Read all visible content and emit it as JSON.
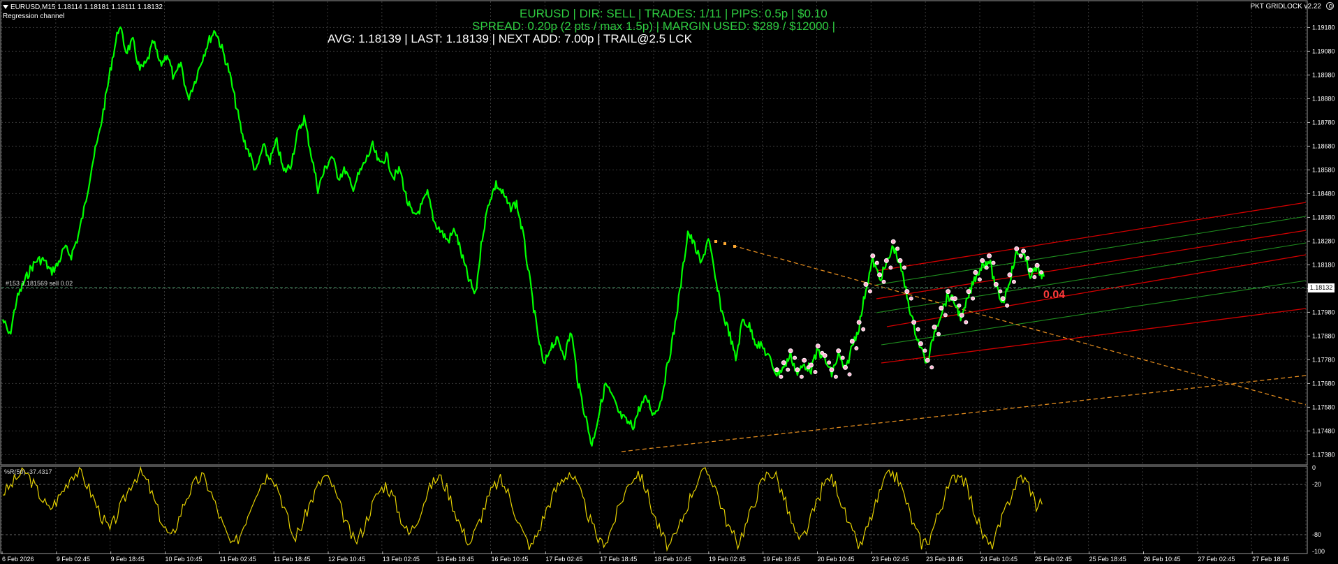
{
  "header": {
    "symbol_info": "EURUSD,M15  1.18114 1.18181 1.18111 1.18132",
    "indicator_name": "Regression channel",
    "ea_name": "PKT GRIDLOCK v2.22"
  },
  "hud": {
    "line1": "EURUSD | DIR: SELL | TRADES: 1/11 | PIPS: 0.5p | $0.10",
    "line2": "SPREAD: 0.20p (2 pts / max 1.5p) | MARGIN USED: $289 / $12000 |",
    "line3": "AVG: 1.18139 | LAST: 1.18139 | NEXT ADD: 7.00p | TRAIL@2.5 LCK"
  },
  "order_label": "#153 1.181569 sell 0.02",
  "current_price": "1.18132",
  "profit_label": "0.04",
  "subwindow": {
    "label": "%R(50) -37.4317",
    "ticks": [
      "0",
      "-20",
      "-80",
      "-100"
    ]
  },
  "colors": {
    "background": "#000000",
    "grid": "#3a3a3a",
    "price_line": "#00ff00",
    "oscillator": "#e6d200",
    "channel_red": "#d40000",
    "channel_green": "#1f8f1f",
    "trend_orange": "#e08a1e",
    "hud_green": "#2ecc40"
  },
  "chart_data": [
    {
      "type": "line",
      "symbol": "EURUSD",
      "timeframe": "M15",
      "y_ticks": [
        "1.19180",
        "1.19080",
        "1.18980",
        "1.18880",
        "1.18780",
        "1.18680",
        "1.18580",
        "1.18480",
        "1.18380",
        "1.18280",
        "1.18180",
        "1.18080",
        "1.17980",
        "1.17880",
        "1.17780",
        "1.17680",
        "1.17580",
        "1.17480",
        "1.17380"
      ],
      "ylim": [
        1.1734,
        1.1929
      ],
      "x_ticks": [
        "6 Feb 2026",
        "9 Feb 02:45",
        "9 Feb 18:45",
        "10 Feb 10:45",
        "11 Feb 02:45",
        "11 Feb 18:45",
        "12 Feb 10:45",
        "13 Feb 02:45",
        "13 Feb 18:45",
        "16 Feb 10:45",
        "17 Feb 02:45",
        "17 Feb 18:45",
        "18 Feb 10:45",
        "19 Feb 02:45",
        "19 Feb 18:45",
        "20 Feb 10:45",
        "23 Feb 02:45",
        "23 Feb 18:45",
        "24 Feb 10:45",
        "25 Feb 02:45",
        "25 Feb 18:45",
        "26 Feb 10:45",
        "27 Feb 02:45",
        "27 Feb 18:45"
      ],
      "series": [
        {
          "values": [
            1.1795,
            1.1788,
            1.1803,
            1.181,
            1.1816,
            1.182,
            1.182,
            1.1815,
            1.1818,
            1.1825,
            1.1822,
            1.183,
            1.1843,
            1.186,
            1.1872,
            1.1888,
            1.1905,
            1.1919,
            1.1908,
            1.1912,
            1.19,
            1.1903,
            1.1912,
            1.1902,
            1.1907,
            1.1896,
            1.1903,
            1.1888,
            1.1895,
            1.1904,
            1.1912,
            1.1917,
            1.1909,
            1.19,
            1.1886,
            1.1872,
            1.1865,
            1.1857,
            1.1868,
            1.1862,
            1.187,
            1.1857,
            1.186,
            1.1873,
            1.188,
            1.1865,
            1.185,
            1.1858,
            1.1864,
            1.1855,
            1.1858,
            1.185,
            1.1856,
            1.1862,
            1.1868,
            1.186,
            1.1864,
            1.1855,
            1.1858,
            1.1845,
            1.1838,
            1.1842,
            1.1848,
            1.1836,
            1.1832,
            1.1828,
            1.1833,
            1.1822,
            1.1812,
            1.1805,
            1.183,
            1.1845,
            1.1852,
            1.1848,
            1.1842,
            1.1844,
            1.183,
            1.181,
            1.179,
            1.1775,
            1.1784,
            1.1786,
            1.178,
            1.179,
            1.1768,
            1.1755,
            1.1742,
            1.1755,
            1.1768,
            1.1762,
            1.1755,
            1.1752,
            1.175,
            1.1758,
            1.1762,
            1.1755,
            1.176,
            1.1775,
            1.179,
            1.181,
            1.1832,
            1.1826,
            1.1818,
            1.183,
            1.1812,
            1.1798,
            1.179,
            1.1778,
            1.1795,
            1.1792,
            1.1785,
            1.1783,
            1.1778,
            1.1772,
            1.1775,
            1.178,
            1.1772,
            1.1776,
            1.1774,
            1.1782,
            1.1778,
            1.1772,
            1.178,
            1.1773,
            1.1784,
            1.1792,
            1.1808,
            1.182,
            1.1812,
            1.1818,
            1.1826,
            1.1818,
            1.1805,
            1.1792,
            1.1783,
            1.1776,
            1.179,
            1.1798,
            1.1805,
            1.1802,
            1.1795,
            1.1805,
            1.1813,
            1.1818,
            1.182,
            1.1808,
            1.1802,
            1.1812,
            1.1823,
            1.1822,
            1.1814,
            1.1816,
            1.1813
          ]
        }
      ]
    },
    {
      "type": "line",
      "indicator": "%R(50)",
      "last_value": -37.4317,
      "ylim": [
        -100,
        0
      ],
      "y_ticks": [
        0,
        -20,
        -80,
        -100
      ],
      "series": [
        {
          "values": [
            -30,
            -22,
            -10,
            -5,
            -20,
            -35,
            -50,
            -40,
            -25,
            -8,
            -5,
            -20,
            -40,
            -60,
            -75,
            -55,
            -35,
            -15,
            -5,
            -20,
            -45,
            -70,
            -85,
            -60,
            -35,
            -20,
            -10,
            -25,
            -50,
            -75,
            -95,
            -80,
            -55,
            -30,
            -15,
            -5,
            -25,
            -55,
            -85,
            -70,
            -45,
            -25,
            -10,
            -20,
            -45,
            -70,
            -90,
            -75,
            -50,
            -30,
            -20,
            -35,
            -60,
            -80,
            -65,
            -40,
            -20,
            -10,
            -25,
            -50,
            -75,
            -90,
            -70,
            -45,
            -25,
            -15,
            -30,
            -55,
            -80,
            -95,
            -75,
            -50,
            -30,
            -15,
            -5,
            -20,
            -45,
            -70,
            -90,
            -85,
            -60,
            -35,
            -15,
            -5,
            -25,
            -55,
            -80,
            -95,
            -80,
            -55,
            -30,
            -10,
            -5,
            -20,
            -50,
            -75,
            -90,
            -70,
            -45,
            -20,
            -5,
            -10,
            -35,
            -65,
            -90,
            -75,
            -50,
            -25,
            -10,
            -25,
            -55,
            -80,
            -95,
            -70,
            -45,
            -20,
            -5,
            -15,
            -40,
            -70,
            -90,
            -85,
            -60,
            -35,
            -15,
            -5,
            -25,
            -55,
            -80,
            -95,
            -75,
            -50,
            -25,
            -10,
            -20,
            -45,
            -37
          ]
        }
      ]
    }
  ]
}
